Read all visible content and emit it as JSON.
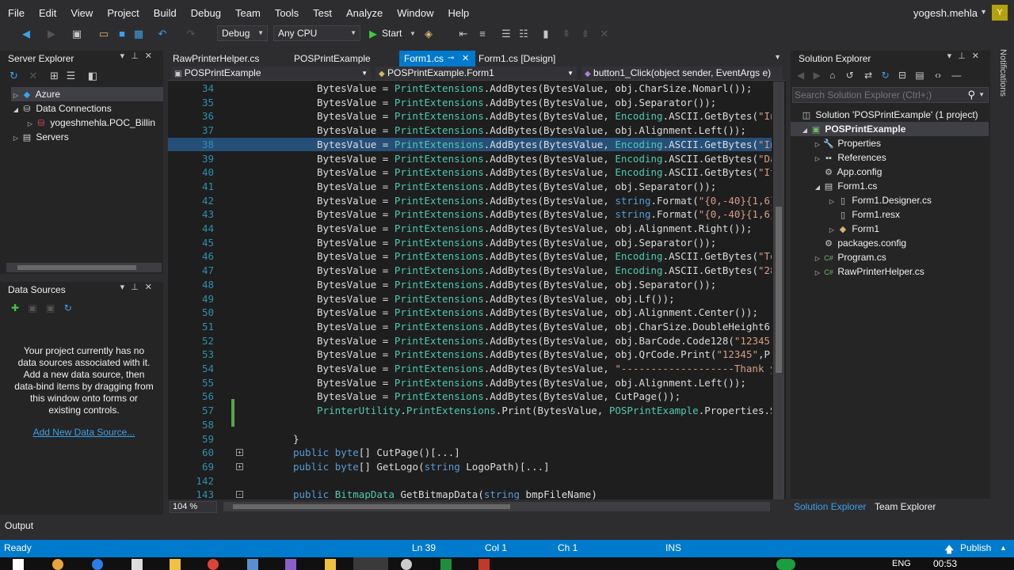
{
  "menu": [
    "File",
    "Edit",
    "View",
    "Project",
    "Build",
    "Debug",
    "Team",
    "Tools",
    "Test",
    "Analyze",
    "Window",
    "Help"
  ],
  "user": {
    "name": "yogesh.mehla",
    "avatar_letter": "Y"
  },
  "toolbar": {
    "config": "Debug",
    "platform": "Any CPU",
    "start": "Start"
  },
  "server_explorer": {
    "title": "Server Explorer",
    "items": [
      {
        "label": "Azure",
        "indent": 0,
        "expander": "right",
        "icon": "azure-icon"
      },
      {
        "label": "Data Connections",
        "indent": 0,
        "expander": "down",
        "icon": "data-connections-icon"
      },
      {
        "label": "yogeshmehla.POC_Billin",
        "indent": 1,
        "expander": "right",
        "icon": "database-icon"
      },
      {
        "label": "Servers",
        "indent": 0,
        "expander": "right",
        "icon": "servers-icon"
      }
    ]
  },
  "data_sources": {
    "title": "Data Sources",
    "message": "Your project currently has no data sources associated with it. Add a new data source, then data-bind items by dragging from this window onto forms or existing controls.",
    "link": "Add New Data Source..."
  },
  "editor": {
    "tabs": [
      "RawPrinterHelper.cs",
      "POSPrintExample",
      "Form1.cs",
      "Form1.cs [Design]"
    ],
    "active_tab": "Form1.cs",
    "nav_project": "POSPrintExample",
    "nav_class": "POSPrintExample.Form1",
    "nav_member": "button1_Click(object sender, EventArgs e)",
    "zoom": "104 %",
    "lines": [
      {
        "n": "34",
        "code": "BytesValue = PrintExtensions.AddBytes(BytesValue, obj.CharSize.Nomarl());"
      },
      {
        "n": "35",
        "code": "BytesValue = PrintExtensions.AddBytes(BytesValue, obj.Separator());"
      },
      {
        "n": "36",
        "code": "BytesValue = PrintExtensions.AddBytes(BytesValue, Encoding.ASCII.GetBytes(\"In"
      },
      {
        "n": "37",
        "code": "BytesValue = PrintExtensions.AddBytes(BytesValue, obj.Alignment.Left());"
      },
      {
        "n": "38",
        "code": "BytesValue = PrintExtensions.AddBytes(BytesValue, Encoding.ASCII.GetBytes(\"In"
      },
      {
        "n": "39",
        "code": "BytesValue = PrintExtensions.AddBytes(BytesValue, Encoding.ASCII.GetBytes(\"Da"
      },
      {
        "n": "40",
        "code": "BytesValue = PrintExtensions.AddBytes(BytesValue, Encoding.ASCII.GetBytes(\"It"
      },
      {
        "n": "41",
        "code": "BytesValue = PrintExtensions.AddBytes(BytesValue, obj.Separator());"
      },
      {
        "n": "42",
        "code": "BytesValue = PrintExtensions.AddBytes(BytesValue, string.Format(\"{0,-40}{1,6}"
      },
      {
        "n": "43",
        "code": "BytesValue = PrintExtensions.AddBytes(BytesValue, string.Format(\"{0,-40}{1,6}"
      },
      {
        "n": "44",
        "code": "BytesValue = PrintExtensions.AddBytes(BytesValue, obj.Alignment.Right());"
      },
      {
        "n": "45",
        "code": "BytesValue = PrintExtensions.AddBytes(BytesValue, obj.Separator());"
      },
      {
        "n": "46",
        "code": "BytesValue = PrintExtensions.AddBytes(BytesValue, Encoding.ASCII.GetBytes(\"To"
      },
      {
        "n": "47",
        "code": "BytesValue = PrintExtensions.AddBytes(BytesValue, Encoding.ASCII.GetBytes(\"28"
      },
      {
        "n": "48",
        "code": "BytesValue = PrintExtensions.AddBytes(BytesValue, obj.Separator());"
      },
      {
        "n": "49",
        "code": "BytesValue = PrintExtensions.AddBytes(BytesValue, obj.Lf());"
      },
      {
        "n": "50",
        "code": "BytesValue = PrintExtensions.AddBytes(BytesValue, obj.Alignment.Center());"
      },
      {
        "n": "51",
        "code": "BytesValue = PrintExtensions.AddBytes(BytesValue, obj.CharSize.DoubleHeight6("
      },
      {
        "n": "52",
        "code": "BytesValue = PrintExtensions.AddBytes(BytesValue, obj.BarCode.Code128(\"12345\""
      },
      {
        "n": "53",
        "code": "BytesValue = PrintExtensions.AddBytes(BytesValue, obj.QrCode.Print(\"12345\",Pr"
      },
      {
        "n": "54",
        "code": "BytesValue = PrintExtensions.AddBytes(BytesValue, \"-------------------Thank y"
      },
      {
        "n": "55",
        "code": "BytesValue = PrintExtensions.AddBytes(BytesValue, obj.Alignment.Left());"
      },
      {
        "n": "56",
        "code": "BytesValue = PrintExtensions.AddBytes(BytesValue, CutPage());"
      },
      {
        "n": "57",
        "code": "PrinterUtility.PrintExtensions.Print(BytesValue, POSPrintExample.Properties.Se"
      },
      {
        "n": "58",
        "code": ""
      },
      {
        "n": "59",
        "code": "}"
      },
      {
        "n": "60",
        "code": "public byte[] CutPage()[...]"
      },
      {
        "n": "69",
        "code": "public byte[] GetLogo(string LogoPath)[...]"
      },
      {
        "n": "142",
        "code": ""
      },
      {
        "n": "143",
        "code": "public BitmapData GetBitmapData(string bmpFileName)"
      }
    ]
  },
  "solution_explorer": {
    "title": "Solution Explorer",
    "search_placeholder": "Search Solution Explorer (Ctrl+;)",
    "items": [
      {
        "label": "Solution 'POSPrintExample' (1 project)",
        "indent": 0,
        "expander": "",
        "icon": "solution-icon",
        "bold": false
      },
      {
        "label": "POSPrintExample",
        "indent": 0,
        "expander": "down",
        "icon": "csharp-project-icon",
        "bold": true
      },
      {
        "label": "Properties",
        "indent": 1,
        "expander": "right",
        "icon": "wrench-icon",
        "bold": false
      },
      {
        "label": "References",
        "indent": 1,
        "expander": "right",
        "icon": "references-icon",
        "bold": false
      },
      {
        "label": "App.config",
        "indent": 1,
        "expander": "",
        "icon": "config-file-icon",
        "bold": false
      },
      {
        "label": "Form1.cs",
        "indent": 1,
        "expander": "down",
        "icon": "form-icon",
        "bold": false
      },
      {
        "label": "Form1.Designer.cs",
        "indent": 2,
        "expander": "right",
        "icon": "csharp-file-icon",
        "bold": false
      },
      {
        "label": "Form1.resx",
        "indent": 2,
        "expander": "",
        "icon": "resx-file-icon",
        "bold": false
      },
      {
        "label": "Form1",
        "indent": 2,
        "expander": "right",
        "icon": "class-icon",
        "bold": false
      },
      {
        "label": "packages.config",
        "indent": 1,
        "expander": "",
        "icon": "config-file-icon",
        "bold": false
      },
      {
        "label": "Program.cs",
        "indent": 1,
        "expander": "right",
        "icon": "csharp-file-icon",
        "bold": false
      },
      {
        "label": "RawPrinterHelper.cs",
        "indent": 1,
        "expander": "right",
        "icon": "csharp-file-icon",
        "bold": false
      }
    ],
    "bottom_tabs": [
      "Solution Explorer",
      "Team Explorer"
    ]
  },
  "notifications": "Notifications",
  "output_label": "Output",
  "status": {
    "ready": "Ready",
    "line": "Ln 39",
    "col": "Col 1",
    "ch": "Ch 1",
    "ins": "INS",
    "publish": "Publish"
  },
  "taskbar": {
    "lang": "ENG",
    "time": "00:53"
  },
  "colors": {
    "accent": "#007acc",
    "background": "#2d2d30",
    "editor_bg": "#1e1e1e",
    "keyword": "#569cd6",
    "type": "#4ec9b0",
    "string": "#d69d85",
    "line_number": "#2b91af"
  }
}
